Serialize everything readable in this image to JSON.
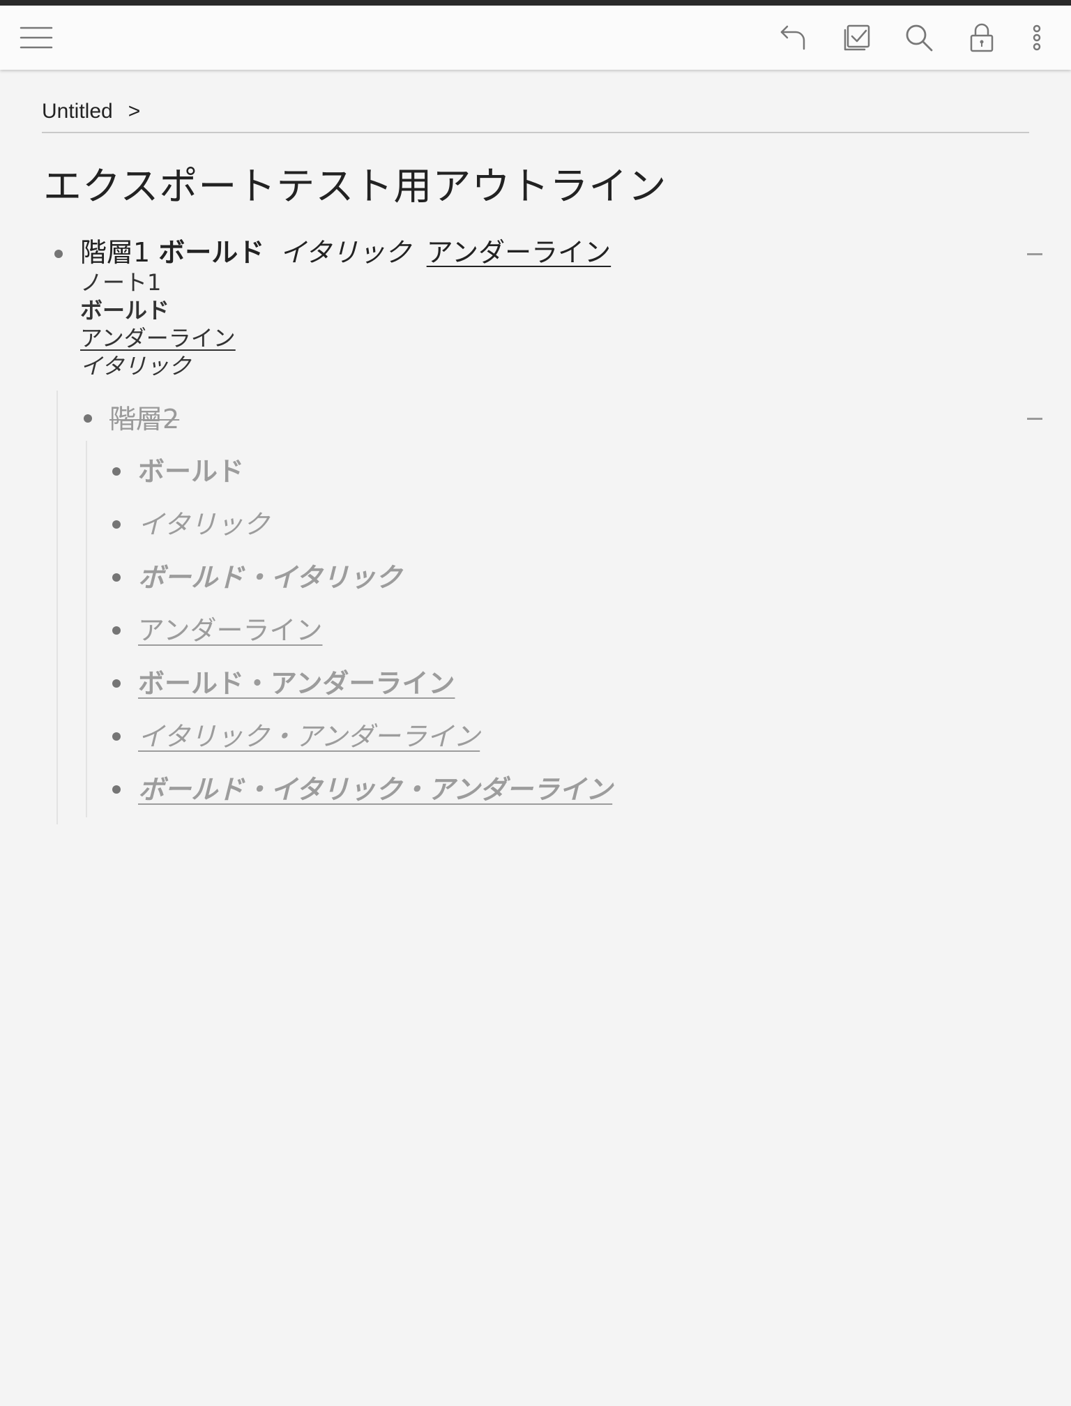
{
  "toolbar": {
    "icons": [
      "menu-icon",
      "undo-icon",
      "checklist-icon",
      "search-icon",
      "lock-icon",
      "more-vert-icon"
    ]
  },
  "breadcrumb": {
    "root": "Untitled",
    "separator": ">"
  },
  "page_title": "エクスポートテスト用アウトライン",
  "outline": {
    "level1": {
      "parts": [
        {
          "text": "階層1",
          "style": "normal"
        },
        {
          "text": "ボールド",
          "style": "bold"
        },
        {
          "text": "イタリック",
          "style": "italic"
        },
        {
          "text": "アンダーライン",
          "style": "underline"
        }
      ],
      "note_lines": [
        {
          "text": "ノート1",
          "style": "normal"
        },
        {
          "text": "ボールド",
          "style": "bold"
        },
        {
          "text": "アンダーライン",
          "style": "underline"
        },
        {
          "text": "イタリック",
          "style": "italic"
        }
      ],
      "collapse": "−"
    },
    "level2": {
      "text": "階層2",
      "completed": true,
      "collapse": "−"
    },
    "level3": [
      {
        "text": "ボールド",
        "style": "bold"
      },
      {
        "text": "イタリック",
        "style": "italic"
      },
      {
        "text": "ボールド・イタリック",
        "style": "bold italic"
      },
      {
        "text": "アンダーライン",
        "style": "underline"
      },
      {
        "text": "ボールド・アンダーライン",
        "style": "bold underline"
      },
      {
        "text": "イタリック・アンダーライン",
        "style": "italic underline"
      },
      {
        "text": "ボールド・イタリック・アンダーライン",
        "style": "bold italic underline"
      }
    ]
  },
  "colors": {
    "background": "#f4f4f4",
    "toolbar": "#fbfbfb",
    "text": "#222222",
    "completed_text": "#9a9a9a",
    "bullet": "#757575"
  }
}
